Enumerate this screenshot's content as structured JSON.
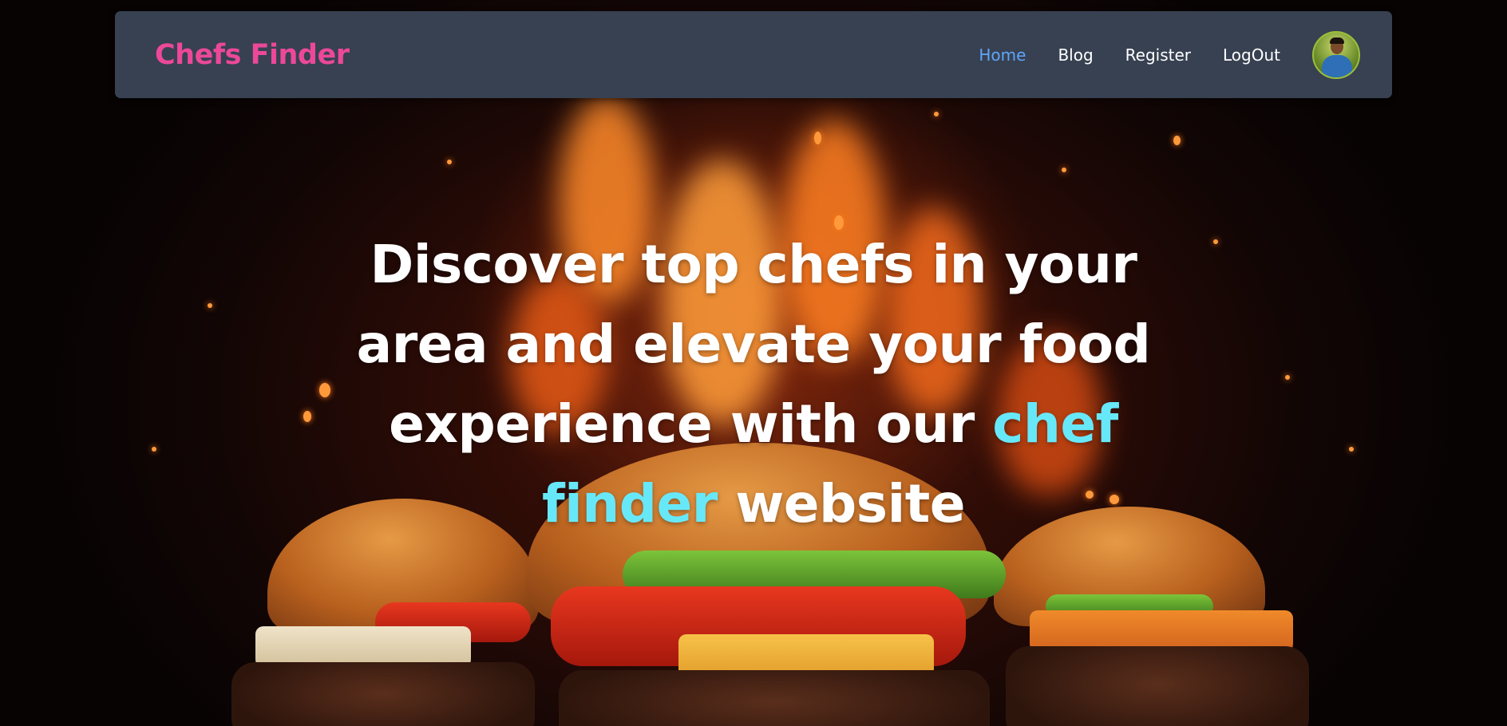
{
  "navbar": {
    "brand": "Chefs Finder",
    "links": [
      {
        "label": "Home",
        "active": true
      },
      {
        "label": "Blog",
        "active": false
      },
      {
        "label": "Register",
        "active": false
      },
      {
        "label": "LogOut",
        "active": false
      }
    ],
    "avatar_icon": "user-avatar"
  },
  "hero": {
    "headline_pre": "Discover top chefs in your area and elevate your food experience with our ",
    "headline_accent": "chef finder",
    "headline_post": " website",
    "background_image": "burgers-on-fire"
  },
  "colors": {
    "navbar_bg": "#374151",
    "brand": "#ec4899",
    "active_link": "#60a5fa",
    "accent_text": "#67e8f9",
    "text": "#ffffff"
  }
}
